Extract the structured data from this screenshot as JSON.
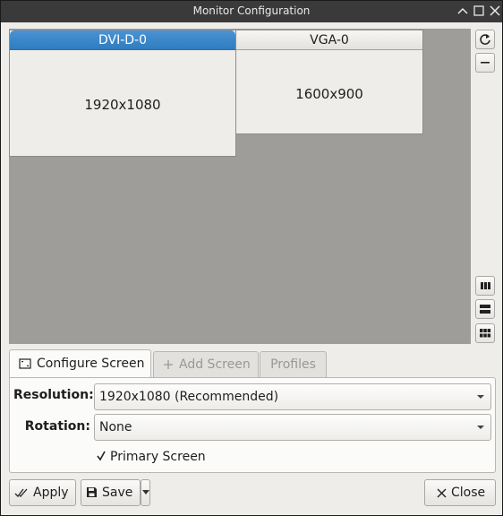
{
  "window": {
    "title": "Monitor Configuration",
    "controls": [
      "minimize-icon",
      "maximize-icon",
      "close-icon"
    ]
  },
  "monitors": [
    {
      "name": "DVI-D-0",
      "resolution": "1920x1080",
      "primary": true
    },
    {
      "name": "VGA-0",
      "resolution": "1600x900",
      "primary": false
    }
  ],
  "toolbar": {
    "top_buttons": [
      "refresh-icon",
      "remove-icon"
    ],
    "bottom_buttons": [
      "columns-layout-icon",
      "rows-layout-icon",
      "grid-layout-icon"
    ]
  },
  "tabs": [
    {
      "label": "Configure Screen",
      "icon": "monitor-icon",
      "active": true,
      "enabled": true
    },
    {
      "label": "Add Screen",
      "icon": "plus-icon",
      "active": false,
      "enabled": false
    },
    {
      "label": "Profiles",
      "active": false,
      "enabled": false
    }
  ],
  "form": {
    "resolution_label": "Resolution:",
    "resolution_value": "1920x1080 (Recommended)",
    "rotation_label": "Rotation:",
    "rotation_value": "None",
    "primary_label": "Primary Screen",
    "primary_checked": true
  },
  "buttons": {
    "apply": "Apply",
    "save": "Save",
    "close": "Close"
  },
  "colors": {
    "primary_header": "#2f7cc0",
    "canvas_bg": "#9e9d99",
    "titlebar_bg": "#3a3a3a"
  }
}
